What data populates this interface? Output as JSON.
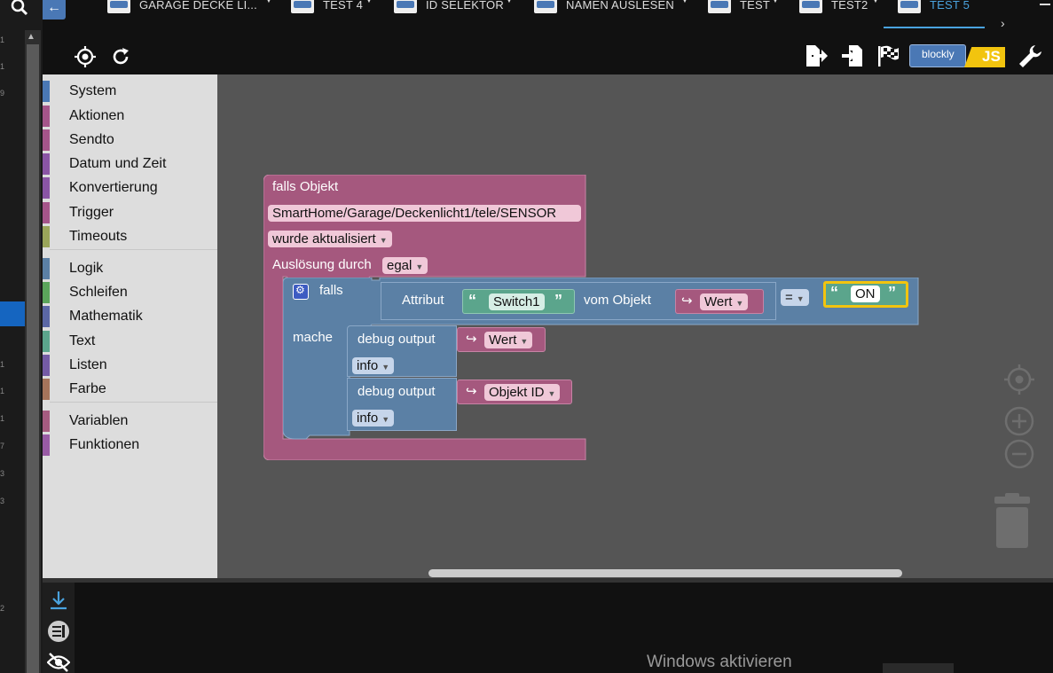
{
  "tabs": [
    {
      "label": "GARAGE DECKE LI...",
      "active": false
    },
    {
      "label": "TEST 4",
      "active": false
    },
    {
      "label": "ID SELEKTOR",
      "active": false
    },
    {
      "label": "NAMEN AUSLESEN",
      "active": false
    },
    {
      "label": "TEST",
      "active": false
    },
    {
      "label": "TEST2",
      "active": false
    },
    {
      "label": "TEST 5",
      "active": true
    }
  ],
  "tabs_next": "›",
  "back_glyph": "←",
  "toolbar": {
    "badge_left": "blockly",
    "badge_right": "JS"
  },
  "left_numbers": [
    "1",
    "1",
    "9",
    "1",
    "1",
    "1",
    "7",
    "3",
    "3",
    "2"
  ],
  "toolbox": {
    "groups": [
      [
        {
          "label": "System",
          "color": "#4a78b5"
        },
        {
          "label": "Aktionen",
          "color": "#a5558a"
        },
        {
          "label": "Sendto",
          "color": "#a5558a"
        },
        {
          "label": "Datum und Zeit",
          "color": "#8a55a5"
        },
        {
          "label": "Konvertierung",
          "color": "#8a55a5"
        },
        {
          "label": "Trigger",
          "color": "#a5558a"
        },
        {
          "label": "Timeouts",
          "color": "#9aa55a"
        }
      ],
      [
        {
          "label": "Logik",
          "color": "#5b80a5"
        },
        {
          "label": "Schleifen",
          "color": "#5ba55b"
        },
        {
          "label": "Mathematik",
          "color": "#5b67a5"
        },
        {
          "label": "Text",
          "color": "#5ba58c"
        },
        {
          "label": "Listen",
          "color": "#745ba5"
        },
        {
          "label": "Farbe",
          "color": "#a5745b"
        }
      ],
      [
        {
          "label": "Variablen",
          "color": "#a55b80"
        },
        {
          "label": "Funktionen",
          "color": "#995ba5"
        }
      ]
    ]
  },
  "blocks": {
    "trigger": {
      "title": "falls Objekt",
      "object_id": "SmartHome/Garage/Deckenlicht1/tele/SENSOR",
      "condition": "wurde aktualisiert",
      "ausloesung_label": "Auslösung durch",
      "ausloesung_value": "egal"
    },
    "if_block": {
      "falls_label": "falls",
      "mache_label": "mache",
      "attribut_label": "Attribut",
      "attribut_value": "Switch1",
      "vom_objekt_label": "vom Objekt",
      "var_wert": "Wert",
      "operator": "=",
      "compare_value": "ON",
      "open_quote": "“",
      "close_quote": "”"
    },
    "debug1": {
      "label": "debug output",
      "var": "Wert",
      "level": "info"
    },
    "debug2": {
      "label": "debug output",
      "var": "Objekt ID",
      "level": "info"
    }
  },
  "bottom": {
    "watermark": "Windows aktivieren"
  }
}
